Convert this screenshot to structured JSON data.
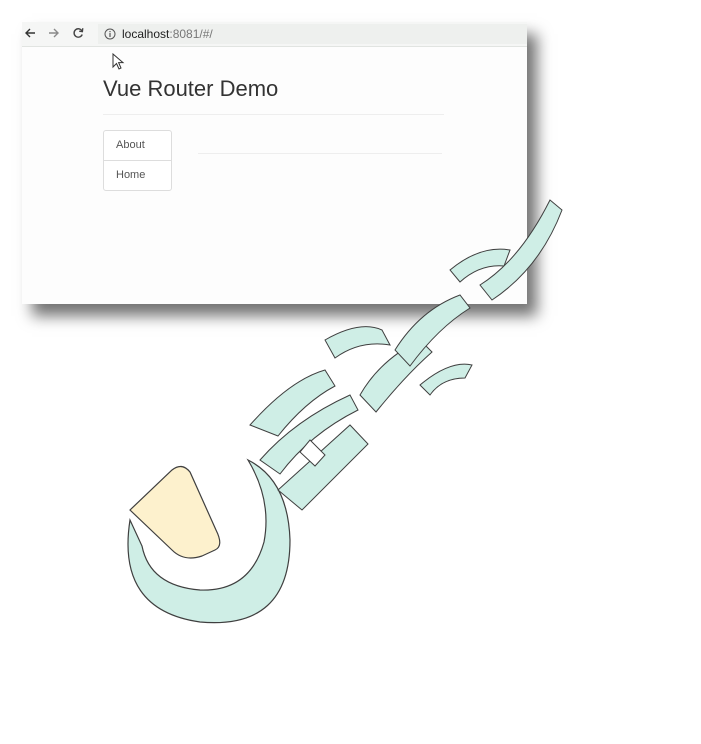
{
  "browser": {
    "back_icon": "arrow-left-icon",
    "forward_icon": "arrow-right-icon",
    "reload_icon": "reload-icon",
    "info_icon": "info-icon",
    "url_host": "localhost",
    "url_rest": ":8081/#/"
  },
  "page": {
    "title": "Vue Router Demo",
    "nav_links": [
      {
        "label": "About"
      },
      {
        "label": "Home"
      }
    ]
  },
  "watermark": {
    "icon": "brand-logo-watermark",
    "colors": {
      "teal": "#cfeee6",
      "yellow": "#fdf1cd",
      "outline": "#3f3f3f"
    }
  }
}
